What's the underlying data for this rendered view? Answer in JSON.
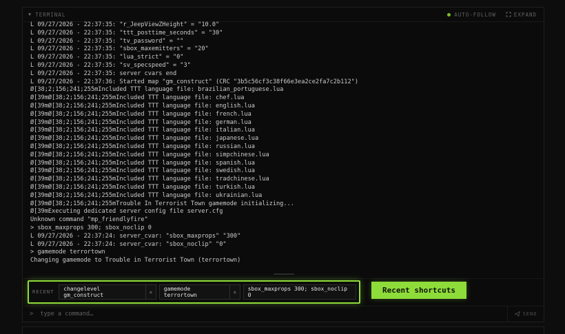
{
  "titlebar": {
    "title": "TERMINAL",
    "auto_follow": "AUTO-FOLLOW",
    "expand": "EXPAND"
  },
  "log": [
    "L 09/27/2026 - 22:37:35: \"r_JeepViewZHeight\" = \"10.0\"",
    "L 09/27/2026 - 22:37:35: \"ttt_posttime_seconds\" = \"30\"",
    "L 09/27/2026 - 22:37:35: \"tv_password\" = \"\"",
    "L 09/27/2026 - 22:37:35: \"sbox_maxemitters\" = \"20\"",
    "L 09/27/2026 - 22:37:35: \"lua_strict\" = \"0\"",
    "L 09/27/2026 - 22:37:35: \"sv_specspeed\" = \"3\"",
    "L 09/27/2026 - 22:37:35: server cvars end",
    "L 09/27/2026 - 22:37:36: Started map \"gm_construct\" (CRC \"3b5c56cf3c38f66e3ea2ce2fa7c2b112\")",
    "Ø[38;2;156;241;255mIncluded TTT language file: brazilian_portuguese.lua",
    "Ø[39mØ[38;2;156;241;255mIncluded TTT language file: chef.lua",
    "Ø[39mØ[38;2;156;241;255mIncluded TTT language file: english.lua",
    "Ø[39mØ[38;2;156;241;255mIncluded TTT language file: french.lua",
    "Ø[39mØ[38;2;156;241;255mIncluded TTT language file: german.lua",
    "Ø[39mØ[38;2;156;241;255mIncluded TTT language file: italian.lua",
    "Ø[39mØ[38;2;156;241;255mIncluded TTT language file: japanese.lua",
    "Ø[39mØ[38;2;156;241;255mIncluded TTT language file: russian.lua",
    "Ø[39mØ[38;2;156;241;255mIncluded TTT language file: simpchinese.lua",
    "Ø[39mØ[38;2;156;241;255mIncluded TTT language file: spanish.lua",
    "Ø[39mØ[38;2;156;241;255mIncluded TTT language file: swedish.lua",
    "Ø[39mØ[38;2;156;241;255mIncluded TTT language file: tradchinese.lua",
    "Ø[39mØ[38;2;156;241;255mIncluded TTT language file: turkish.lua",
    "Ø[39mØ[38;2;156;241;255mIncluded TTT language file: ukrainian.lua",
    "Ø[39mØ[38;2;156;241;255mTrouble In Terrorist Town gamemode initializing...",
    "Ø[39mExecuting dedicated server config file server.cfg",
    "Unknown command \"mp_friendlyfire\"",
    "> sbox_maxprops 300; sbox_noclip 0",
    "L 09/27/2026 - 22:37:24: server_cvar: \"sbox_maxprops\" \"300\"",
    "L 09/27/2026 - 22:37:24: server_cvar: \"sbox_noclip\" \"0\"",
    "> gamemode terrortown",
    "Changing gamemode to Trouble in Terrorist Town (terrortown)"
  ],
  "recent": {
    "label": "RECENT",
    "items": [
      {
        "text": "changelevel gm_construct",
        "close": "×"
      },
      {
        "text": "gamemode terrortown",
        "close": "×"
      },
      {
        "text": "sbox_maxprops 300; sbox_noclip 0"
      }
    ]
  },
  "shortcuts_button": "Recent shortcuts",
  "input": {
    "prompt": ">",
    "placeholder": "type a command…",
    "send_label": "SEND"
  },
  "colors": {
    "accent": "#8edc3a",
    "background": "#0d0d0d"
  }
}
